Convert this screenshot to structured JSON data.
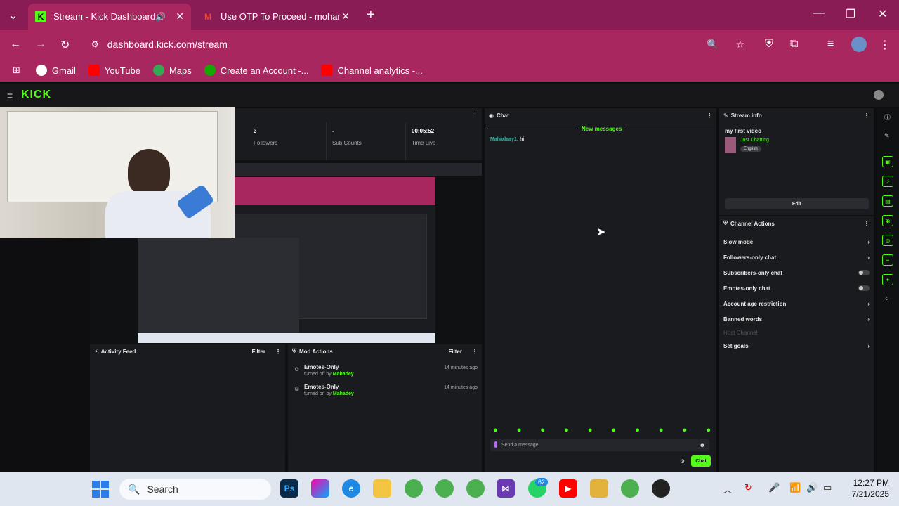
{
  "browser": {
    "tabs": [
      {
        "title": "Stream - Kick Dashboard",
        "favicon": "K"
      },
      {
        "title": "Use OTP To Proceed - mohame",
        "favicon": "M"
      }
    ],
    "url": "dashboard.kick.com/stream",
    "bookmarks": [
      "Gmail",
      "YouTube",
      "Maps",
      "Create an Account -...",
      "Channel analytics -..."
    ]
  },
  "kick": {
    "logo": "KICK",
    "stats": [
      {
        "value": "3",
        "label": "Followers"
      },
      {
        "value": "-",
        "label": "Sub Counts"
      },
      {
        "value": "00:05:52",
        "label": "Time Live"
      }
    ],
    "activity_feed": {
      "title": "Activity Feed",
      "filter": "Filter"
    },
    "mod_actions": {
      "title": "Mod Actions",
      "filter": "Filter",
      "items": [
        {
          "title": "Emotes-Only",
          "desc": "turned off by",
          "user": "Mahadey",
          "time": "14 minutes ago"
        },
        {
          "title": "Emotes-Only",
          "desc": "turned on by",
          "user": "Mahadey",
          "time": "14 minutes ago"
        }
      ]
    },
    "chat": {
      "title": "Chat",
      "new_messages": "New messages",
      "messages": [
        {
          "user": "Mahadaay1:",
          "text": "hi"
        }
      ],
      "placeholder": "Send a message",
      "send_label": "Chat"
    },
    "stream_info": {
      "title": "Stream info",
      "stream_title": "my first video",
      "category": "Just Chatting",
      "language": "English",
      "edit": "Edit"
    },
    "channel_actions": {
      "title": "Channel Actions",
      "items": [
        {
          "label": "Slow mode",
          "control": "chevron"
        },
        {
          "label": "Followers-only chat",
          "control": "chevron"
        },
        {
          "label": "Subscribers-only chat",
          "control": "toggle"
        },
        {
          "label": "Emotes-only chat",
          "control": "toggle"
        },
        {
          "label": "Account age restriction",
          "control": "chevron"
        },
        {
          "label": "Banned words",
          "control": "chevron"
        },
        {
          "label": "Host Channel",
          "control": "none"
        },
        {
          "label": "Set goals",
          "control": "chevron"
        }
      ]
    }
  },
  "taskbar": {
    "search": "Search",
    "time": "12:27 PM",
    "date": "7/21/2025",
    "badge": "62"
  }
}
